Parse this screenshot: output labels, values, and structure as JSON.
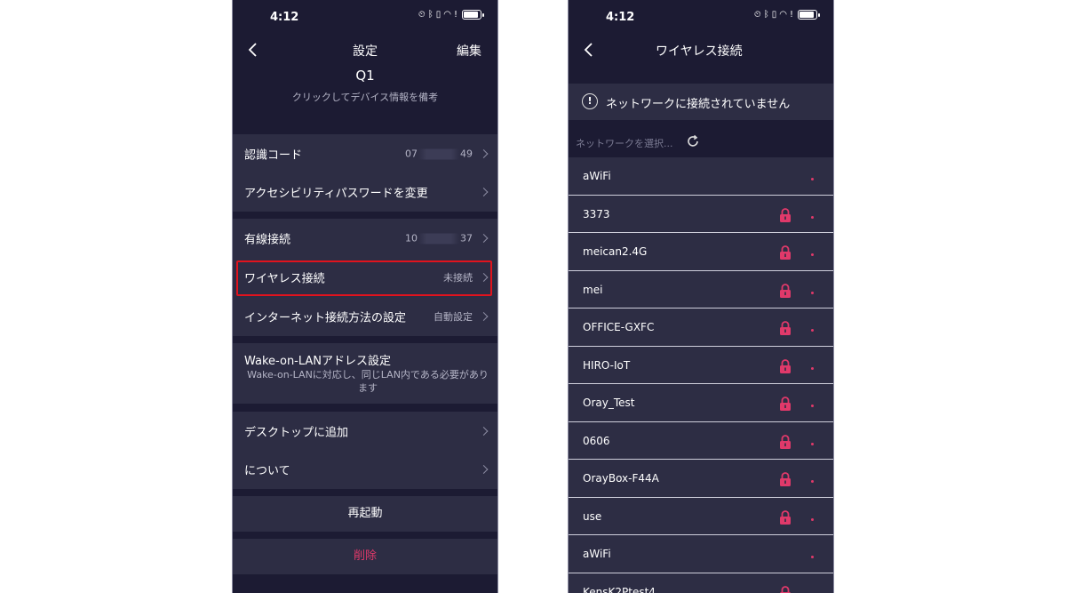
{
  "left_screen": {
    "status": {
      "time": "4:12"
    },
    "nav": {
      "title": "設定",
      "edit_label": "編集"
    },
    "device": {
      "name": "Q1",
      "hint": "クリックしてデバイス情報を備考"
    },
    "rows": {
      "auth_code": {
        "label": "認識コード",
        "value_prefix": "07",
        "value_suffix": "49"
      },
      "access_password": {
        "label": "アクセシビリティパスワードを変更"
      },
      "wired": {
        "label": "有線接続",
        "value_prefix": "10",
        "value_suffix": "37"
      },
      "wireless": {
        "label": "ワイヤレス接続",
        "value": "未接続"
      },
      "internet_method": {
        "label": "インターネット接続方法の設定",
        "value": "自動設定"
      },
      "wol": {
        "label": "Wake-on-LANアドレス設定",
        "description": "Wake-on-LANに対応し、同じLAN内である必要があります"
      },
      "add_desktop": {
        "label": "デスクトップに追加"
      },
      "about": {
        "label": "について"
      }
    },
    "actions": {
      "reboot": "再起動",
      "delete": "削除"
    },
    "colors": {
      "background": "#1c1b33",
      "card": "#2d2d44",
      "highlight": "#e0131d",
      "danger": "#e0396a"
    }
  },
  "right_screen": {
    "status": {
      "time": "4:12"
    },
    "nav": {
      "title": "ワイヤレス接続"
    },
    "banner": {
      "text": "ネットワークに接続されていません"
    },
    "search": {
      "placeholder": "ネットワークを選択..."
    },
    "networks": [
      {
        "ssid": "aWiFi",
        "locked": false
      },
      {
        "ssid": "3373",
        "locked": true
      },
      {
        "ssid": "meican2.4G",
        "locked": true
      },
      {
        "ssid": "mei",
        "locked": true
      },
      {
        "ssid": "OFFICE-GXFC",
        "locked": true
      },
      {
        "ssid": "HIRO-IoT",
        "locked": true
      },
      {
        "ssid": "Oray_Test",
        "locked": true
      },
      {
        "ssid": "0606",
        "locked": true
      },
      {
        "ssid": "OrayBox-F44A",
        "locked": true
      },
      {
        "ssid": "use",
        "locked": true
      },
      {
        "ssid": "aWiFi",
        "locked": false
      },
      {
        "ssid": "KensK2Ptest4",
        "locked": true
      }
    ],
    "colors": {
      "lock": "#e0396a",
      "signal": "#e0396a"
    }
  }
}
